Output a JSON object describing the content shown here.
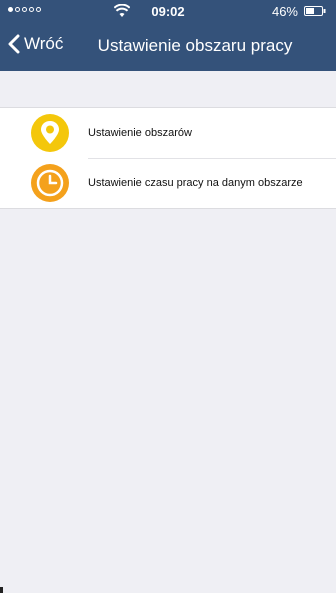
{
  "status_bar": {
    "time": "09:02",
    "battery_percent": "46%",
    "signal_bars_filled": 1,
    "signal_bars_total": 5
  },
  "nav": {
    "back_label": "Wróć",
    "title": "Ustawienie obszaru pracy"
  },
  "menu": {
    "items": [
      {
        "label": "Ustawienie obszarów",
        "icon": "location-pin-icon",
        "color": "#f4c70b"
      },
      {
        "label": "Ustawienie czasu pracy na danym obszarze",
        "icon": "clock-icon",
        "color": "#f4a11c"
      }
    ]
  },
  "colors": {
    "header": "#34527a",
    "background": "#efeff4",
    "indicator": "#37c837"
  }
}
